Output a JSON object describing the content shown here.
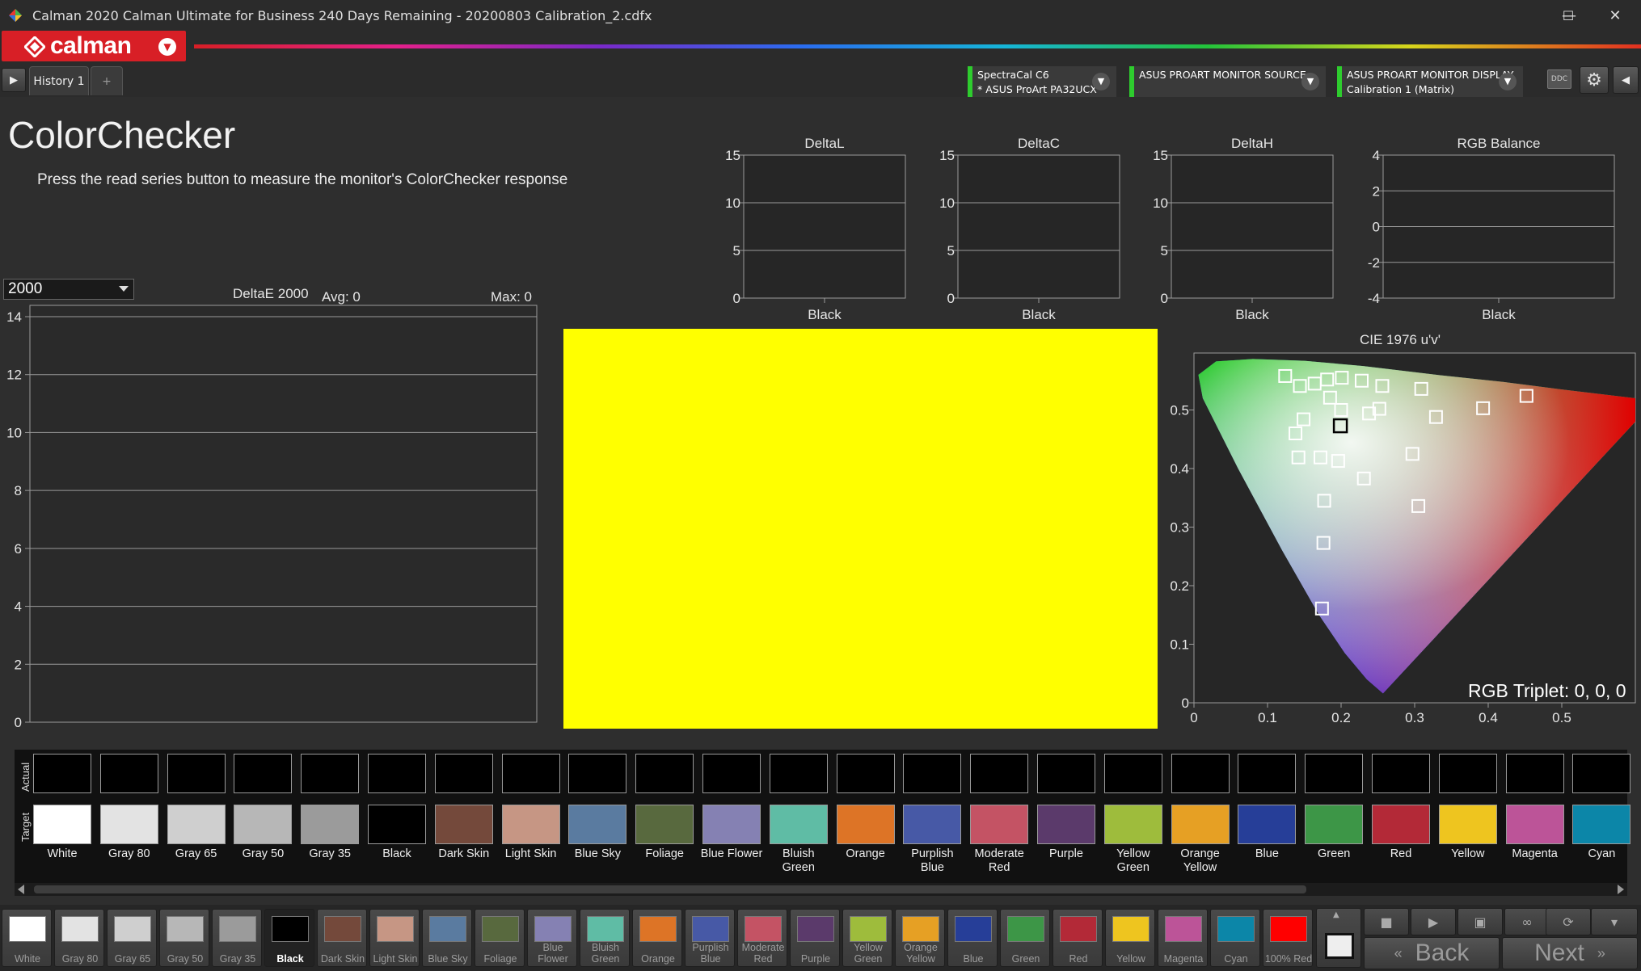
{
  "window": {
    "title": "Calman 2020 Calman Ultimate for Business 240 Days Remaining  -  20200803 Calibration_2.cdfx",
    "minimize": "—",
    "maximize": "☐",
    "close": "✕"
  },
  "brand": {
    "logo": "calman",
    "accent": "#d81f26"
  },
  "tabs": {
    "history": "History 1",
    "add": "+"
  },
  "devices": {
    "meter": {
      "line1": "SpectraCal C6",
      "line2": "* ASUS ProArt PA32UCX"
    },
    "source": {
      "line1": "ASUS PROART MONITOR SOURCE",
      "line2": ""
    },
    "display": {
      "line1": "ASUS PROART MONITOR DISPLAY",
      "line2": "Calibration 1 (Matrix)"
    },
    "ddc_label": "DDC"
  },
  "page": {
    "heading": "ColorChecker",
    "instruction": "Press the read series button to measure the monitor's ColorChecker response"
  },
  "metric_select": {
    "value": "2000"
  },
  "deltae_chart": {
    "title": "DeltaE 2000",
    "avg": "Avg: 0",
    "max": "Max: 0"
  },
  "small_charts": [
    {
      "title": "DeltaL",
      "category": "Black"
    },
    {
      "title": "DeltaC",
      "category": "Black"
    },
    {
      "title": "DeltaH",
      "category": "Black"
    },
    {
      "title": "RGB Balance",
      "category": "Black"
    }
  ],
  "preview_color": "#ffff00",
  "cie": {
    "title": "CIE 1976 u'v'",
    "rgb_triplet": "RGB Triplet: 0, 0, 0"
  },
  "chart_data": [
    {
      "type": "bar",
      "title": "DeltaE 2000",
      "categories": [],
      "values": [],
      "ylim": [
        0,
        14
      ],
      "yticks": [
        "0",
        "2",
        "4",
        "6",
        "8",
        "10",
        "12",
        "14"
      ],
      "grid": true
    },
    {
      "type": "bar",
      "title": "DeltaL",
      "categories": [
        "Black"
      ],
      "values": [
        0
      ],
      "ylim": [
        0,
        15
      ],
      "yticks": [
        "0",
        "5",
        "10",
        "15"
      ]
    },
    {
      "type": "bar",
      "title": "DeltaC",
      "categories": [
        "Black"
      ],
      "values": [
        0
      ],
      "ylim": [
        0,
        15
      ],
      "yticks": [
        "0",
        "5",
        "10",
        "15"
      ]
    },
    {
      "type": "bar",
      "title": "DeltaH",
      "categories": [
        "Black"
      ],
      "values": [
        0
      ],
      "ylim": [
        0,
        15
      ],
      "yticks": [
        "0",
        "5",
        "10",
        "15"
      ]
    },
    {
      "type": "bar",
      "title": "RGB Balance",
      "categories": [
        "Black"
      ],
      "values": [
        0
      ],
      "ylim": [
        -4,
        4
      ],
      "yticks": [
        "-4",
        "-2",
        "0",
        "2",
        "4"
      ]
    },
    {
      "type": "scatter",
      "title": "CIE 1976 u'v'",
      "xlim": [
        0,
        0.6
      ],
      "ylim": [
        0,
        0.6
      ],
      "xticks": [
        "0",
        "0.1",
        "0.2",
        "0.3",
        "0.4",
        "0.5"
      ],
      "yticks": [
        "0",
        "0.1",
        "0.2",
        "0.3",
        "0.4",
        "0.5"
      ],
      "targets": [
        [
          0.124,
          0.558
        ],
        [
          0.144,
          0.541
        ],
        [
          0.164,
          0.545
        ],
        [
          0.181,
          0.552
        ],
        [
          0.201,
          0.555
        ],
        [
          0.228,
          0.55
        ],
        [
          0.256,
          0.541
        ],
        [
          0.309,
          0.536
        ],
        [
          0.185,
          0.521
        ],
        [
          0.2,
          0.5
        ],
        [
          0.238,
          0.494
        ],
        [
          0.252,
          0.502
        ],
        [
          0.329,
          0.488
        ],
        [
          0.393,
          0.503
        ],
        [
          0.452,
          0.524
        ],
        [
          0.149,
          0.484
        ],
        [
          0.138,
          0.46
        ],
        [
          0.142,
          0.419
        ],
        [
          0.172,
          0.419
        ],
        [
          0.196,
          0.413
        ],
        [
          0.231,
          0.383
        ],
        [
          0.297,
          0.425
        ],
        [
          0.305,
          0.336
        ],
        [
          0.177,
          0.345
        ],
        [
          0.176,
          0.273
        ],
        [
          0.174,
          0.161
        ]
      ],
      "selected": [
        0.199,
        0.473
      ]
    }
  ],
  "swatch_strip": {
    "actual_label": "Actual",
    "target_label": "Target",
    "items": [
      {
        "name": "White",
        "color": "#ffffff"
      },
      {
        "name": "Gray 80",
        "color": "#e3e3e3"
      },
      {
        "name": "Gray 65",
        "color": "#cfcfcf"
      },
      {
        "name": "Gray 50",
        "color": "#b7b7b7"
      },
      {
        "name": "Gray 35",
        "color": "#9b9b9b"
      },
      {
        "name": "Black",
        "color": "#000000"
      },
      {
        "name": "Dark Skin",
        "color": "#74493b"
      },
      {
        "name": "Light Skin",
        "color": "#c69684"
      },
      {
        "name": "Blue Sky",
        "color": "#5a7ba0"
      },
      {
        "name": "Foliage",
        "color": "#58693e"
      },
      {
        "name": "Blue Flower",
        "color": "#8581b3"
      },
      {
        "name": "Bluish Green",
        "color": "#5fbca5"
      },
      {
        "name": "Orange",
        "color": "#dd7426"
      },
      {
        "name": "Purplish Blue",
        "color": "#4759a6"
      },
      {
        "name": "Moderate Red",
        "color": "#c45364"
      },
      {
        "name": "Purple",
        "color": "#5b3a6b"
      },
      {
        "name": "Yellow Green",
        "color": "#9ebc3c"
      },
      {
        "name": "Orange Yellow",
        "color": "#e6a024"
      },
      {
        "name": "Blue",
        "color": "#263e98"
      },
      {
        "name": "Green",
        "color": "#3d9647"
      },
      {
        "name": "Red",
        "color": "#b32937"
      },
      {
        "name": "Yellow",
        "color": "#eec51f"
      },
      {
        "name": "Magenta",
        "color": "#bc5498"
      },
      {
        "name": "Cyan",
        "color": "#0c86a8"
      }
    ]
  },
  "bottom_bar": {
    "items": [
      {
        "label": "White",
        "color": "#ffffff"
      },
      {
        "label": "Gray 80",
        "color": "#e3e3e3"
      },
      {
        "label": "Gray 65",
        "color": "#cfcfcf"
      },
      {
        "label": "Gray 50",
        "color": "#b7b7b7"
      },
      {
        "label": "Gray 35",
        "color": "#9b9b9b"
      },
      {
        "label": "Black",
        "color": "#000000",
        "selected": true
      },
      {
        "label": "Dark Skin",
        "color": "#74493b"
      },
      {
        "label": "Light Skin",
        "color": "#c69684"
      },
      {
        "label": "Blue Sky",
        "color": "#5a7ba0"
      },
      {
        "label": "Foliage",
        "color": "#58693e"
      },
      {
        "label": "Blue Flower",
        "color": "#8581b3"
      },
      {
        "label": "Bluish Green",
        "color": "#5fbca5"
      },
      {
        "label": "Orange",
        "color": "#dd7426"
      },
      {
        "label": "Purplish Blue",
        "color": "#4759a6"
      },
      {
        "label": "Moderate Red",
        "color": "#c45364"
      },
      {
        "label": "Purple",
        "color": "#5b3a6b"
      },
      {
        "label": "Yellow Green",
        "color": "#9ebc3c"
      },
      {
        "label": "Orange Yellow",
        "color": "#e6a024"
      },
      {
        "label": "Blue",
        "color": "#263e98"
      },
      {
        "label": "Green",
        "color": "#3d9647"
      },
      {
        "label": "Red",
        "color": "#b32937"
      },
      {
        "label": "Yellow",
        "color": "#eec51f"
      },
      {
        "label": "Magenta",
        "color": "#bc5498"
      },
      {
        "label": "Cyan",
        "color": "#0c86a8"
      },
      {
        "label": "100% Red",
        "color": "#ff0000"
      }
    ],
    "back": "Back",
    "next": "Next"
  }
}
